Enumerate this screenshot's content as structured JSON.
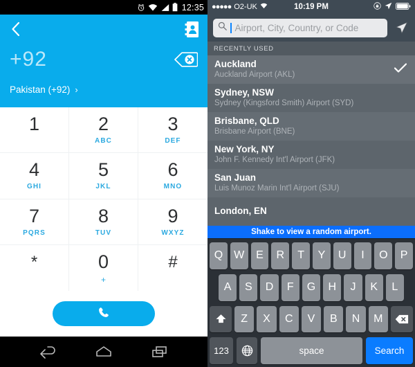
{
  "android": {
    "status_bar": {
      "time": "12:35",
      "icons": [
        "alarm-icon",
        "wifi-icon",
        "signal-icon",
        "battery-icon"
      ]
    },
    "header": {
      "back_label": "‹",
      "contacts_icon": "contacts-book-icon",
      "phone_number": "+92",
      "delete_icon": "backspace-icon",
      "country_label": "Pakistan (+92)",
      "country_chevron": "›"
    },
    "keypad": [
      {
        "digit": "1",
        "letters": ""
      },
      {
        "digit": "2",
        "letters": "ABC"
      },
      {
        "digit": "3",
        "letters": "DEF"
      },
      {
        "digit": "4",
        "letters": "GHI"
      },
      {
        "digit": "5",
        "letters": "JKL"
      },
      {
        "digit": "6",
        "letters": "MNO"
      },
      {
        "digit": "7",
        "letters": "PQRS"
      },
      {
        "digit": "8",
        "letters": "TUV"
      },
      {
        "digit": "9",
        "letters": "WXYZ"
      },
      {
        "digit": "*",
        "letters": ""
      },
      {
        "digit": "0",
        "letters": "+"
      },
      {
        "digit": "#",
        "letters": ""
      }
    ],
    "call_button": {
      "icon": "phone-handset-icon"
    },
    "nav_bar": {
      "back": "back-icon",
      "home": "home-icon",
      "recents": "recents-icon"
    },
    "colors": {
      "accent": "#09ACEC",
      "key_letter": "#2BA9E0"
    }
  },
  "ios": {
    "status_bar": {
      "signal_dots": "●●●●●",
      "carrier": "O2-UK",
      "wifi_icon": "wifi-icon",
      "time": "10:19 PM",
      "rotation_lock_icon": "rotation-lock-icon",
      "location_icon": "location-arrow-icon",
      "battery_icon": "battery-icon"
    },
    "search": {
      "placeholder": "Airport, City, Country, or Code",
      "value": "",
      "search_icon": "search-icon",
      "locate_icon": "location-arrow-icon"
    },
    "section_header": "RECENTLY USED",
    "airports": [
      {
        "city": "Auckland",
        "airport": "Auckland Airport (AKL)",
        "selected": true
      },
      {
        "city": "Sydney, NSW",
        "airport": "Sydney (Kingsford Smith) Airport (SYD)",
        "selected": false
      },
      {
        "city": "Brisbane, QLD",
        "airport": "Brisbane Airport (BNE)",
        "selected": false
      },
      {
        "city": "New York, NY",
        "airport": "John F. Kennedy Int'l Airport (JFK)",
        "selected": false
      },
      {
        "city": "San Juan",
        "airport": "Luis Munoz Marin Int'l Airport (SJU)",
        "selected": false
      },
      {
        "city": "London, EN",
        "airport": "",
        "selected": false
      }
    ],
    "banner": "Shake to view a random airport.",
    "keyboard": {
      "row1": [
        "Q",
        "W",
        "E",
        "R",
        "T",
        "Y",
        "U",
        "I",
        "O",
        "P"
      ],
      "row2": [
        "A",
        "S",
        "D",
        "F",
        "G",
        "H",
        "J",
        "K",
        "L"
      ],
      "row3": [
        "Z",
        "X",
        "C",
        "V",
        "B",
        "N",
        "M"
      ],
      "shift_icon": "shift-arrow-icon",
      "backspace_icon": "backspace-icon",
      "numeric_label": "123",
      "globe_icon": "globe-icon",
      "space_label": "space",
      "search_label": "Search"
    },
    "colors": {
      "accent": "#0a7cff",
      "banner": "#0b6efd",
      "list_bg": "#656d74"
    }
  }
}
